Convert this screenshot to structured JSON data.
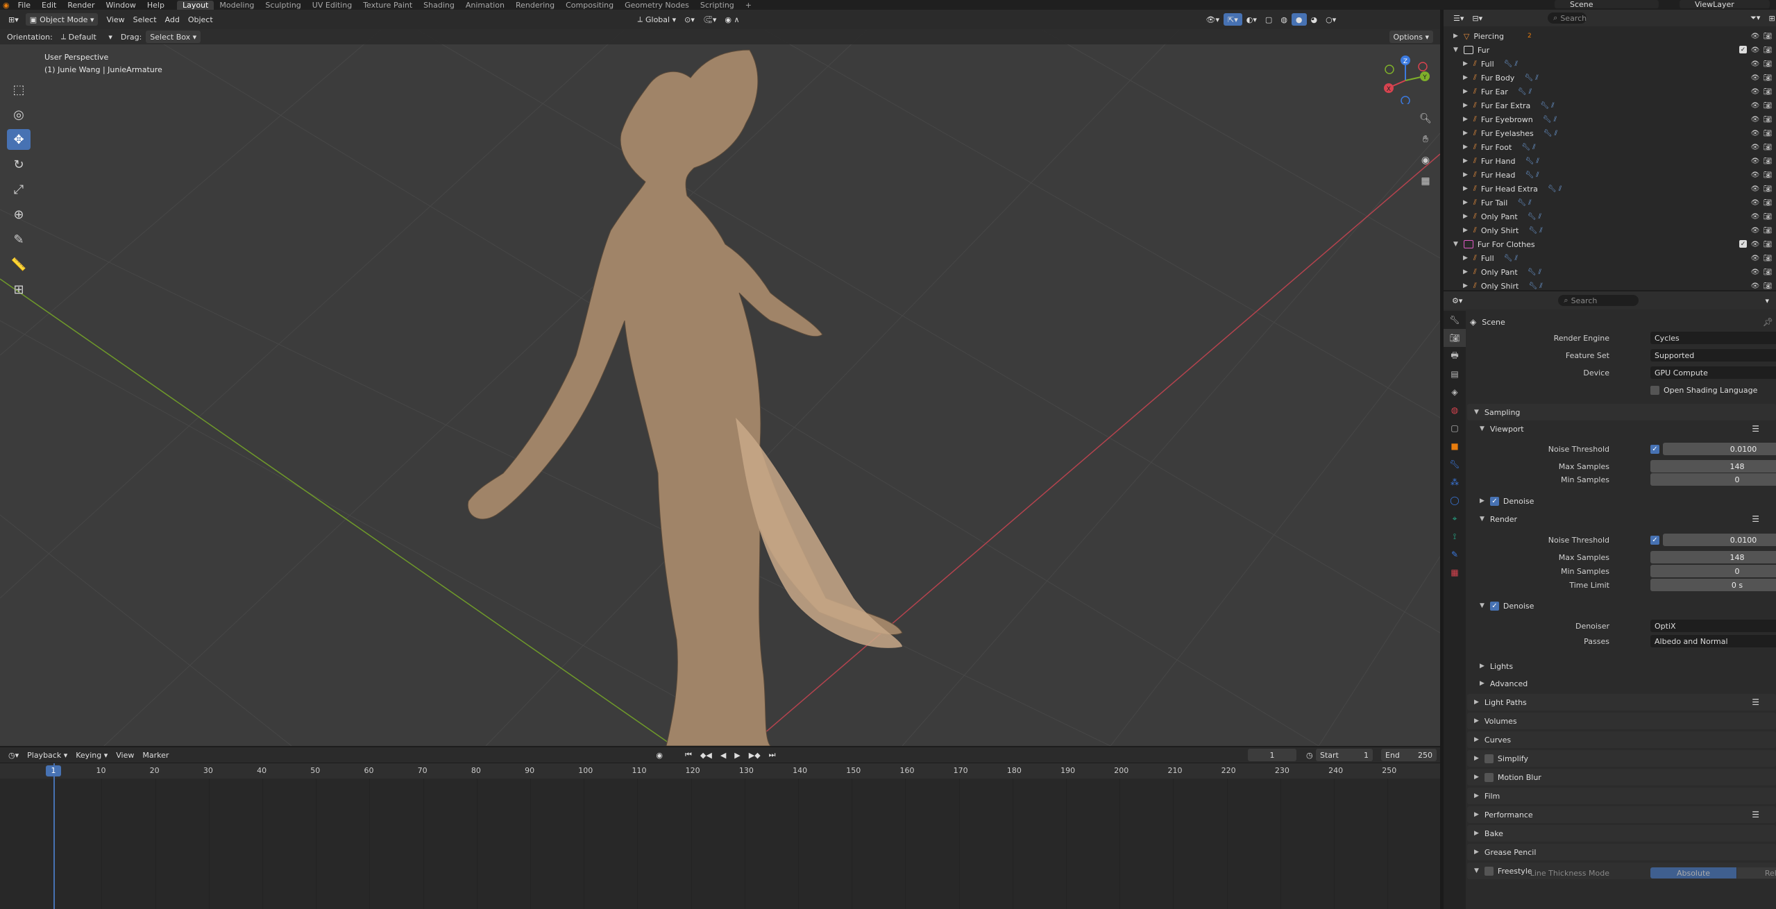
{
  "app_menu": [
    "File",
    "Edit",
    "Render",
    "Window",
    "Help"
  ],
  "workspaces": [
    "Layout",
    "Modeling",
    "Sculpting",
    "UV Editing",
    "Texture Paint",
    "Shading",
    "Animation",
    "Rendering",
    "Compositing",
    "Geometry Nodes",
    "Scripting"
  ],
  "active_workspace": "Layout",
  "scene_name": "Scene",
  "view_layer": "ViewLayer",
  "viewport_header": {
    "mode": "Object Mode",
    "menus": [
      "View",
      "Select",
      "Add",
      "Object"
    ],
    "transform_orientation": "Global",
    "options": "Options"
  },
  "tool_settings": {
    "orientation_label": "Orientation:",
    "orientation_value": "Default",
    "drag_label": "Drag:",
    "drag_value": "Select Box"
  },
  "viewport_overlay": {
    "view_name": "User Perspective",
    "object_info": "(1) Junie Wang | JunieArmature"
  },
  "gizmo": {
    "z": "Z",
    "y": "Y",
    "x": "X"
  },
  "outliner": {
    "search_placeholder": "Search",
    "rows": [
      {
        "label": "Piercing",
        "type": "object",
        "indent": 0,
        "badge": "2"
      },
      {
        "label": "Fur",
        "type": "collection",
        "indent": 0
      },
      {
        "label": "Full",
        "type": "hair",
        "indent": 1
      },
      {
        "label": "Fur Body",
        "type": "hair",
        "indent": 1
      },
      {
        "label": "Fur Ear",
        "type": "hair",
        "indent": 1
      },
      {
        "label": "Fur Ear Extra",
        "type": "hair",
        "indent": 1
      },
      {
        "label": "Fur Eyebrown",
        "type": "hair",
        "indent": 1
      },
      {
        "label": "Fur Eyelashes",
        "type": "hair",
        "indent": 1
      },
      {
        "label": "Fur Foot",
        "type": "hair",
        "indent": 1
      },
      {
        "label": "Fur Hand",
        "type": "hair",
        "indent": 1
      },
      {
        "label": "Fur Head",
        "type": "hair",
        "indent": 1
      },
      {
        "label": "Fur Head Extra",
        "type": "hair",
        "indent": 1
      },
      {
        "label": "Fur Tail",
        "type": "hair",
        "indent": 1
      },
      {
        "label": "Only Pant",
        "type": "hair",
        "indent": 1
      },
      {
        "label": "Only Shirt",
        "type": "hair",
        "indent": 1
      },
      {
        "label": "Fur For Clothes",
        "type": "collection",
        "indent": 0
      },
      {
        "label": "Full",
        "type": "hair",
        "indent": 1
      },
      {
        "label": "Only Pant",
        "type": "hair",
        "indent": 1
      },
      {
        "label": "Only Shirt",
        "type": "hair",
        "indent": 1
      }
    ]
  },
  "properties": {
    "search_placeholder": "Search",
    "context": "Scene",
    "render_engine_label": "Render Engine",
    "render_engine": "Cycles",
    "feature_set_label": "Feature Set",
    "feature_set": "Supported",
    "device_label": "Device",
    "device": "GPU Compute",
    "osl_label": "Open Shading Language",
    "sampling": "Sampling",
    "viewport": "Viewport",
    "vp_noise_label": "Noise Threshold",
    "vp_noise": "0.0100",
    "vp_max_label": "Max Samples",
    "vp_max": "148",
    "vp_min_label": "Min Samples",
    "vp_min": "0",
    "vp_denoise": "Denoise",
    "render": "Render",
    "r_noise_label": "Noise Threshold",
    "r_noise": "0.0100",
    "r_max_label": "Max Samples",
    "r_max": "148",
    "r_min_label": "Min Samples",
    "r_min": "0",
    "r_time_label": "Time Limit",
    "r_time": "0 s",
    "r_denoise": "Denoise",
    "denoiser_label": "Denoiser",
    "denoiser": "OptiX",
    "passes_label": "Passes",
    "passes": "Albedo and Normal",
    "lights": "Lights",
    "advanced": "Advanced",
    "panels": [
      "Light Paths",
      "Volumes",
      "Curves",
      "Simplify",
      "Motion Blur",
      "Film",
      "Performance",
      "Bake",
      "Grease Pencil",
      "Freestyle"
    ],
    "line_thickness_label": "Line Thickness Mode",
    "thickness_absolute": "Absolute",
    "thickness_relative": "Relative"
  },
  "timeline": {
    "menus": [
      "Playback",
      "Keying",
      "View",
      "Marker"
    ],
    "current_frame": "1",
    "start_label": "Start",
    "start": "1",
    "end_label": "End",
    "end": "250",
    "ticks": [
      "10",
      "20",
      "30",
      "40",
      "50",
      "60",
      "70",
      "80",
      "90",
      "100",
      "110",
      "120",
      "130",
      "140",
      "150",
      "160",
      "170",
      "180",
      "190",
      "200",
      "210",
      "220",
      "230",
      "240",
      "250"
    ],
    "playhead": "1"
  }
}
